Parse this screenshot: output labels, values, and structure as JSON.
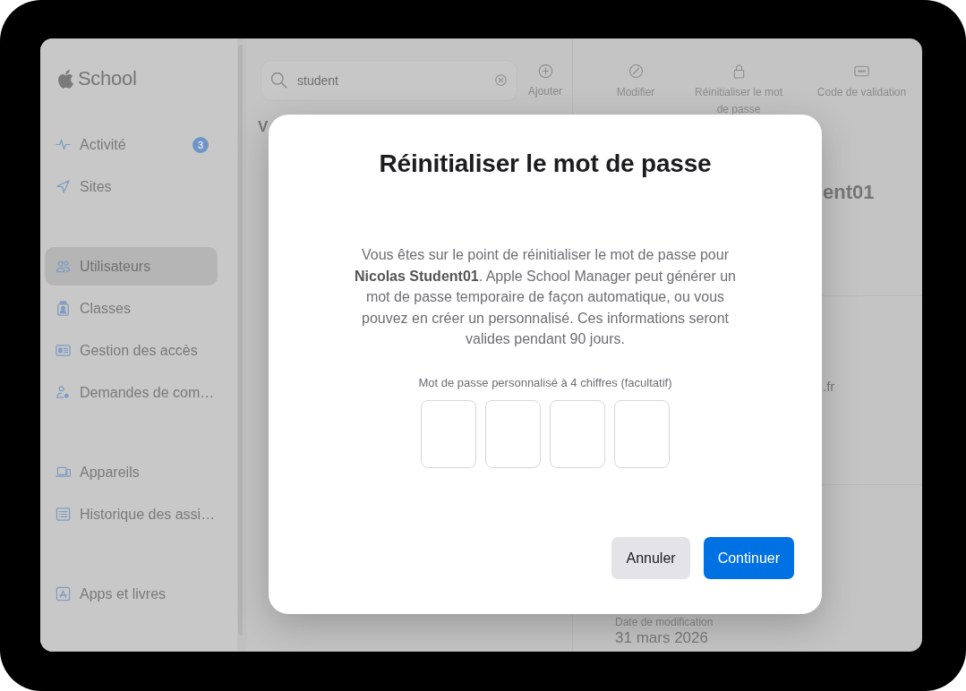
{
  "sidebar": {
    "logo": "School",
    "sections": [
      {
        "items": [
          {
            "label": "Activité",
            "selected": false,
            "badge": "3"
          },
          {
            "label": "Sites",
            "selected": false
          }
        ]
      },
      {
        "items": [
          {
            "label": "Utilisateurs",
            "selected": true
          },
          {
            "label": "Classes",
            "selected": false
          },
          {
            "label": "Gestion des accès",
            "selected": false
          },
          {
            "label": "Demandes de com…",
            "selected": false
          }
        ]
      },
      {
        "items": [
          {
            "label": "Appareils",
            "selected": false
          },
          {
            "label": "Historique des assi…",
            "selected": false
          }
        ]
      },
      {
        "items": [
          {
            "label": "Apps et livres",
            "selected": false
          }
        ]
      }
    ]
  },
  "list_pane": {
    "search": {
      "value": "student"
    },
    "add_button": {
      "label": "Ajouter"
    },
    "heading": "V"
  },
  "detail_pane": {
    "actions": [
      {
        "label": "Modifier"
      },
      {
        "label": "Réinitialiser le mot de passe"
      },
      {
        "label": "Code de validation"
      }
    ],
    "name": "ent01",
    "email": ".fr",
    "fields": [
      {
        "label": "Date de modification",
        "value": "31 mars 2026"
      }
    ]
  },
  "dialog": {
    "title": "Réinitialiser le mot de passe",
    "message": "Vous êtes sur le point de réinitialiser le mot de passe pour **Nicolas Student01**. Apple School Manager peut générer un mot de passe temporaire de façon automatique, ou vous pouvez en créer un personnalisé. Ces informations seront valides pendant 90 jours.",
    "code_label": "Mot de passe personnalisé à 4 chiffres (facultatif)",
    "code_fields": [
      {
        "filled": false
      },
      {
        "filled": false
      },
      {
        "filled": false
      },
      {
        "filled": false
      }
    ],
    "buttons": [
      {
        "label": "Annuler",
        "kind": "secondary"
      },
      {
        "label": "Continuer",
        "kind": "primary"
      }
    ]
  }
}
